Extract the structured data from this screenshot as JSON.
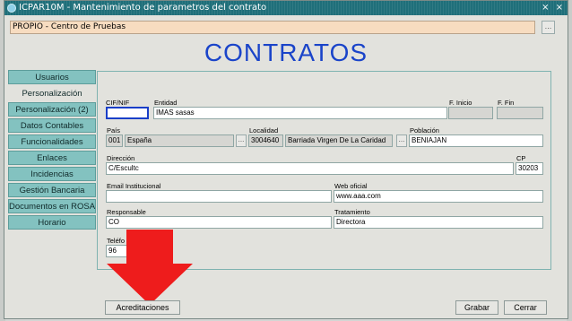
{
  "window": {
    "title": "ICPAR10M - Mantenimiento de parametros del contrato",
    "controls": "⨯ ×"
  },
  "context": {
    "value": "PROPIO - Centro de Pruebas",
    "lov_label": "..."
  },
  "heading": "CONTRATOS",
  "nav": {
    "items": [
      {
        "label": "Usuarios"
      },
      {
        "label": "Personalización"
      },
      {
        "label": "Personalización (2)"
      },
      {
        "label": "Datos Contables"
      },
      {
        "label": "Funcionalidades"
      },
      {
        "label": "Enlaces"
      },
      {
        "label": "Incidencias"
      },
      {
        "label": "Gestión Bancaria"
      },
      {
        "label": "Documentos en ROSA"
      },
      {
        "label": "Horario"
      }
    ]
  },
  "form": {
    "cif": {
      "label": "CIF/NIF",
      "value": ""
    },
    "entidad": {
      "label": "Entidad",
      "value": "IMAS  sasas"
    },
    "f_inicio": {
      "label": "F. Inicio",
      "value": ""
    },
    "f_fin": {
      "label": "F. Fin",
      "value": ""
    },
    "pais": {
      "label": "País",
      "code": "001",
      "name": "España"
    },
    "localidad": {
      "label": "Localidad",
      "code": "3004640",
      "name": "Barriada Virgen De La Caridad"
    },
    "poblacion": {
      "label": "Población",
      "value": "BENIAJAN"
    },
    "direccion": {
      "label": "Dirección",
      "value": "C/Escultc"
    },
    "cp": {
      "label": "CP",
      "value": "30203"
    },
    "email": {
      "label": "Email Institucional",
      "value": ""
    },
    "web": {
      "label": "Web oficial",
      "value": "www.aaa.com"
    },
    "responsable": {
      "label": "Responsable",
      "value": "CO"
    },
    "tratamiento": {
      "label": "Tratamiento",
      "value": "Directora"
    },
    "telefono": {
      "label": "Teléfo",
      "value": "96"
    },
    "lov_label": "..."
  },
  "buttons": {
    "acreditaciones": "Acreditaciones",
    "grabar": "Grabar",
    "cerrar": "Cerrar"
  },
  "colors": {
    "titlebar": "#1f6f7a",
    "heading": "#1a44c9",
    "nav_tab": "#83c2c0",
    "context_field": "#f7dcc0",
    "annotation_arrow": "#ee1c1c"
  }
}
